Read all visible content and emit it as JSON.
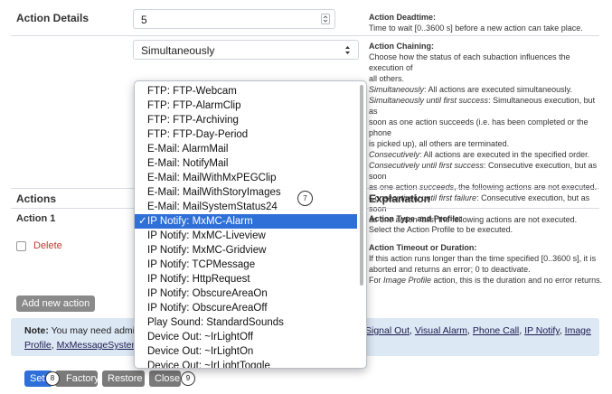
{
  "action_details": {
    "label": "Action Details",
    "deadtime_value": "5",
    "chaining_value": "Simultaneously"
  },
  "help_deadtime": {
    "title": "Action Deadtime",
    "text": "Time to wait [0..3600 s] before a new action can take place."
  },
  "help_chaining": {
    "title": "Action Chaining",
    "line1": "Choose how the status of each subaction influences the execution of",
    "line2": "all others.",
    "sim_term": "Simultaneously",
    "sim_text": ": All actions are executed simultaneously.",
    "suf_term": "Simultaneously until first success",
    "suf_text": ": Simultaneous execution, but as",
    "suf_line2": "soon as one action succeeds (i.e. has been completed or the phone",
    "suf_line3": "is picked up), all others are terminated.",
    "con_term": "Consecutively",
    "con_text": ": All actions are executed in the specified order.",
    "cus_term": "Consecutively until first success",
    "cus_text": ": Consecutive execution, but as soon",
    "cus_line2a": "as one action ",
    "cus_line2b": "succeeds",
    "cus_line2c": ", the following actions are not executed.",
    "cuf_term": "Consecutively until first failure",
    "cuf_text": ": Consecutive execution, but as soon",
    "cuf_line2a": "as one action ",
    "cuf_line2b": "fails",
    "cuf_line2c": ", the following actions are not executed."
  },
  "actions_header": {
    "actions": "Actions",
    "explanation": "Explanation"
  },
  "action1": {
    "label": "Action 1",
    "delete": "Delete"
  },
  "help_type": {
    "title": "Action Type and Profile",
    "text": "Select the Action Profile to be executed."
  },
  "help_timeout": {
    "title": "Action Timeout or Duration",
    "line1": "If this action runs longer than the time specified [0..3600 s], it is",
    "line2": "aborted and returns an error; 0 to deactivate.",
    "line3a": "For ",
    "line3b": "Image Profile",
    "line3c": " action, this is the duration and no error returns."
  },
  "add_new_action": "Add new action",
  "note": {
    "bold": "Note:",
    "text": " You may need admi",
    "links_right": [
      "Signal Out",
      "Visual Alarm",
      "Phone Call",
      "IP Notify",
      "Image"
    ],
    "links_left": [
      "Profile",
      "MxMessageSystem"
    ]
  },
  "buttons": {
    "set": "Set",
    "factory": "Factory",
    "restore": "Restore",
    "close": "Close"
  },
  "badges": {
    "seven": "7",
    "eight": "8",
    "nine": "9"
  },
  "dropdown": {
    "items": [
      "FTP: FTP-Webcam",
      "FTP: FTP-AlarmClip",
      "FTP: FTP-Archiving",
      "FTP: FTP-Day-Period",
      "E-Mail: AlarmMail",
      "E-Mail: NotifyMail",
      "E-Mail: MailWithMxPEGClip",
      "E-Mail: MailWithStoryImages",
      "E-Mail: MailSystemStatus24",
      "IP Notify: MxMC-Alarm",
      "IP Notify: MxMC-Liveview",
      "IP Notify: MxMC-Gridview",
      "IP Notify: TCPMessage",
      "IP Notify: HttpRequest",
      "IP Notify: ObscureAreaOn",
      "IP Notify: ObscureAreaOff",
      "Play Sound: StandardSounds",
      "Device Out: ~IrLightOff",
      "Device Out: ~IrLightOn",
      "Device Out: ~IrLightToggle"
    ],
    "selected_index": 9,
    "check_mark": "✓"
  },
  "colors": {
    "accent": "#2e6fd8",
    "note_bg": "#dde8f5",
    "button_gray": "#7a7a7a",
    "delete_red": "#c0392b"
  }
}
